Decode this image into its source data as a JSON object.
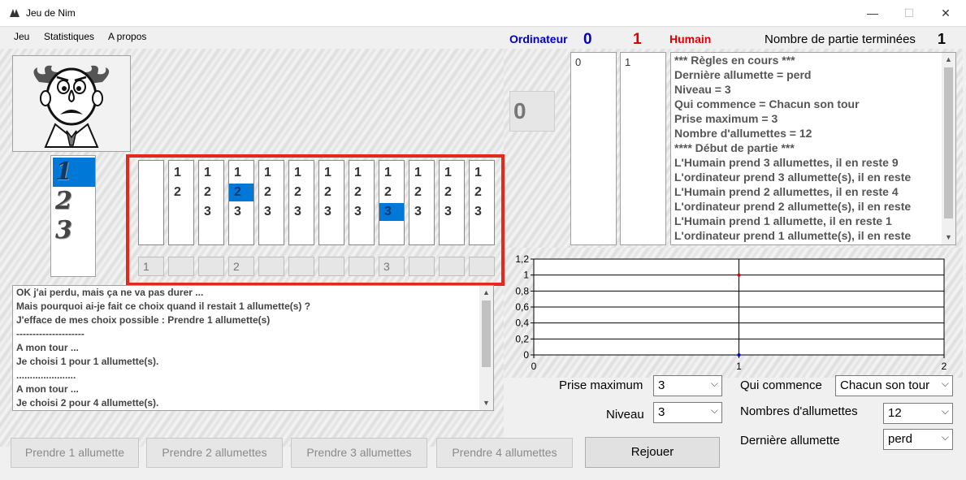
{
  "window": {
    "title": "Jeu de Nim",
    "minimize": "—",
    "maximize": "☐",
    "close": "✕"
  },
  "menu": [
    "Jeu",
    "Statistiques",
    "A propos"
  ],
  "score": {
    "ordinateur_label": "Ordinateur",
    "ordinateur_score": "0",
    "humain_score": "1",
    "humain_label": "Humain",
    "parties_label": "Nombre de partie terminées",
    "parties_count": "1",
    "ordinateur_color": "#0000cc",
    "humain_color": "#e00000"
  },
  "levels": {
    "items": [
      "1",
      "2",
      "3"
    ],
    "selected": "1"
  },
  "matches": {
    "columns": [
      {
        "nums": [],
        "pick": "1"
      },
      {
        "nums": [
          "1",
          "2"
        ],
        "pick": ""
      },
      {
        "nums": [
          "1",
          "2",
          "3"
        ],
        "pick": ""
      },
      {
        "nums": [
          "1",
          "2",
          "3"
        ],
        "selected": "2",
        "pick": "2"
      },
      {
        "nums": [
          "1",
          "2",
          "3"
        ],
        "pick": ""
      },
      {
        "nums": [
          "1",
          "2",
          "3"
        ],
        "pick": ""
      },
      {
        "nums": [
          "1",
          "2",
          "3"
        ],
        "pick": ""
      },
      {
        "nums": [
          "1",
          "2",
          "3"
        ],
        "pick": ""
      },
      {
        "nums": [
          "1",
          "2",
          "3"
        ],
        "selected": "3",
        "pick": "3"
      },
      {
        "nums": [
          "1",
          "2",
          "3"
        ],
        "pick": ""
      },
      {
        "nums": [
          "1",
          "2",
          "3"
        ],
        "pick": ""
      },
      {
        "nums": [
          "1",
          "2",
          "3"
        ],
        "pick": ""
      }
    ]
  },
  "ai_log": [
    "OK j'ai perdu, mais ça ne va pas durer ...",
    "Mais pourquoi ai-je fait ce choix quand il restait 1 allumette(s) ?",
    "J'efface de mes choix possible : Prendre 1 allumette(s)",
    "---------------------",
    "A mon tour ...",
    "Je choisi 1 pour 1 allumette(s).",
    "......................",
    "A mon tour ...",
    "Je choisi 2 pour 4 allumette(s)."
  ],
  "counter": "0",
  "history": {
    "ordinateur": "0",
    "humain": "1"
  },
  "rules_log": [
    "*** Règles en cours ***",
    "Dernière allumette = perd",
    "Niveau = 3",
    "Qui commence = Chacun son tour",
    "Prise maximum = 3",
    "Nombre d'allumettes = 12",
    "**** Début de partie ***",
    "L'Humain prend 3 allumettes, il en reste 9",
    "L'ordinateur prend 3 allumette(s), il en reste",
    "L'Humain prend 2 allumettes, il en reste 4",
    "L'ordinateur prend 2 allumette(s), il en reste",
    "L'Humain prend 1 allumette, il en reste 1",
    "L'ordinateur prend 1 allumette(s), il en reste"
  ],
  "chart_data": {
    "type": "line",
    "title": "",
    "xlabel": "",
    "ylabel": "",
    "xlim": [
      0,
      2
    ],
    "ylim": [
      0,
      1.2
    ],
    "x_ticks": [
      "0",
      "1",
      "2"
    ],
    "y_ticks": [
      "0",
      "0,2",
      "0,4",
      "0,6",
      "0,8",
      "1",
      "1,2"
    ],
    "grid": "horizontal",
    "series": [
      {
        "x": [
          1
        ],
        "values": [
          1
        ],
        "color": "#e00000"
      },
      {
        "x": [
          1
        ],
        "values": [
          0
        ],
        "color": "#0000cc"
      }
    ]
  },
  "settings": {
    "prise_max_label": "Prise maximum",
    "prise_max_value": "3",
    "niveau_label": "Niveau",
    "niveau_value": "3",
    "qui_label": "Qui commence",
    "qui_value": "Chacun son tour",
    "nb_label": "Nombres d'allumettes",
    "nb_value": "12",
    "derniere_label": "Dernière allumette",
    "derniere_value": "perd"
  },
  "buttons": {
    "take1": "Prendre 1 allumette",
    "take2": "Prendre 2 allumettes",
    "take3": "Prendre 3 allumettes",
    "take4": "Prendre 4 allumettes",
    "replay": "Rejouer"
  }
}
